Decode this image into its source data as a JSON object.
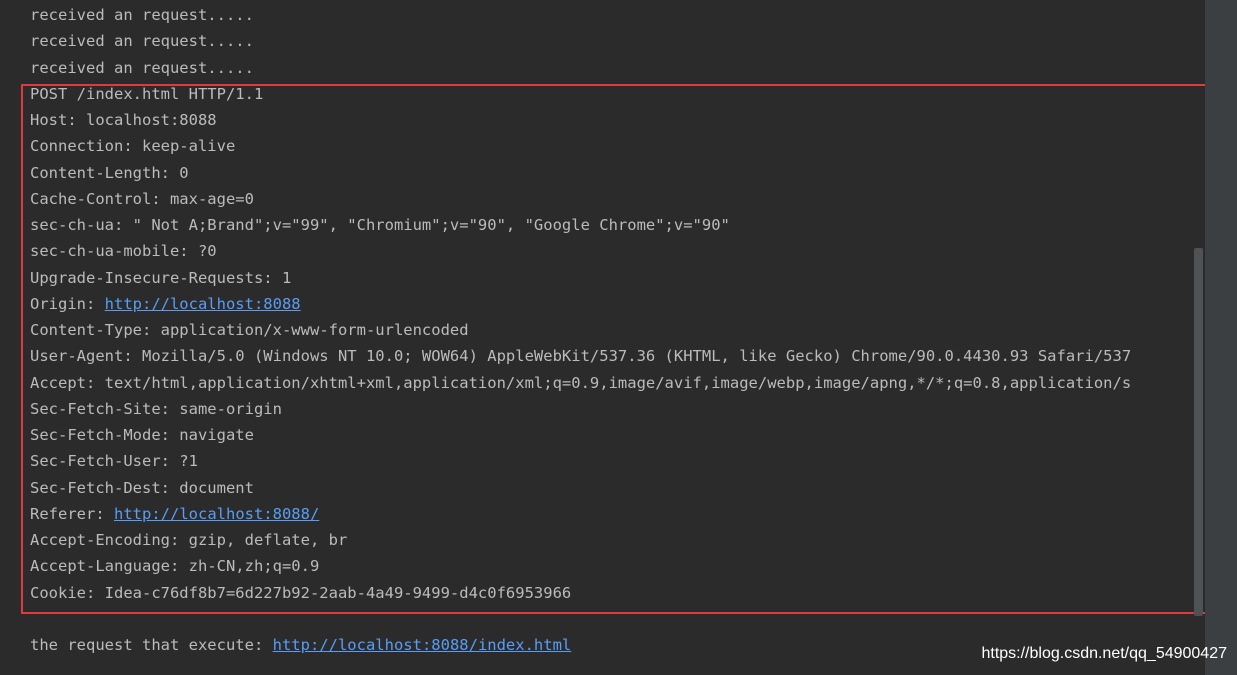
{
  "console": {
    "pre_lines": [
      "received an request.....",
      "received an request.....",
      "received an request....."
    ],
    "request": {
      "request_line": "POST /index.html HTTP/1.1",
      "host": "Host: localhost:8088",
      "connection": "Connection: keep-alive",
      "content_length": "Content-Length: 0",
      "cache_control": "Cache-Control: max-age=0",
      "sec_ch_ua": "sec-ch-ua: \" Not A;Brand\";v=\"99\", \"Chromium\";v=\"90\", \"Google Chrome\";v=\"90\"",
      "sec_ch_ua_mobile": "sec-ch-ua-mobile: ?0",
      "upgrade_insecure_requests": "Upgrade-Insecure-Requests: 1",
      "origin_label": "Origin: ",
      "origin_url": "http://localhost:8088",
      "content_type": "Content-Type: application/x-www-form-urlencoded",
      "user_agent": "User-Agent: Mozilla/5.0 (Windows NT 10.0; WOW64) AppleWebKit/537.36 (KHTML, like Gecko) Chrome/90.0.4430.93 Safari/537",
      "accept": "Accept: text/html,application/xhtml+xml,application/xml;q=0.9,image/avif,image/webp,image/apng,*/*;q=0.8,application/s",
      "sec_fetch_site": "Sec-Fetch-Site: same-origin",
      "sec_fetch_mode": "Sec-Fetch-Mode: navigate",
      "sec_fetch_user": "Sec-Fetch-User: ?1",
      "sec_fetch_dest": "Sec-Fetch-Dest: document",
      "referer_label": "Referer: ",
      "referer_url": "http://localhost:8088/",
      "accept_encoding": "Accept-Encoding: gzip, deflate, br",
      "accept_language": "Accept-Language: zh-CN,zh;q=0.9",
      "cookie": "Cookie: Idea-c76df8b7=6d227b92-2aab-4a49-9499-d4c0f6953966"
    },
    "execute_label": "the request that execute: ",
    "execute_url": "http://localhost:8088/index.html"
  },
  "watermark": "https://blog.csdn.net/qq_54900427",
  "colors": {
    "background": "#2b2b2b",
    "text": "#bbbbbb",
    "link": "#589df6",
    "highlight_border": "#e0393e"
  }
}
